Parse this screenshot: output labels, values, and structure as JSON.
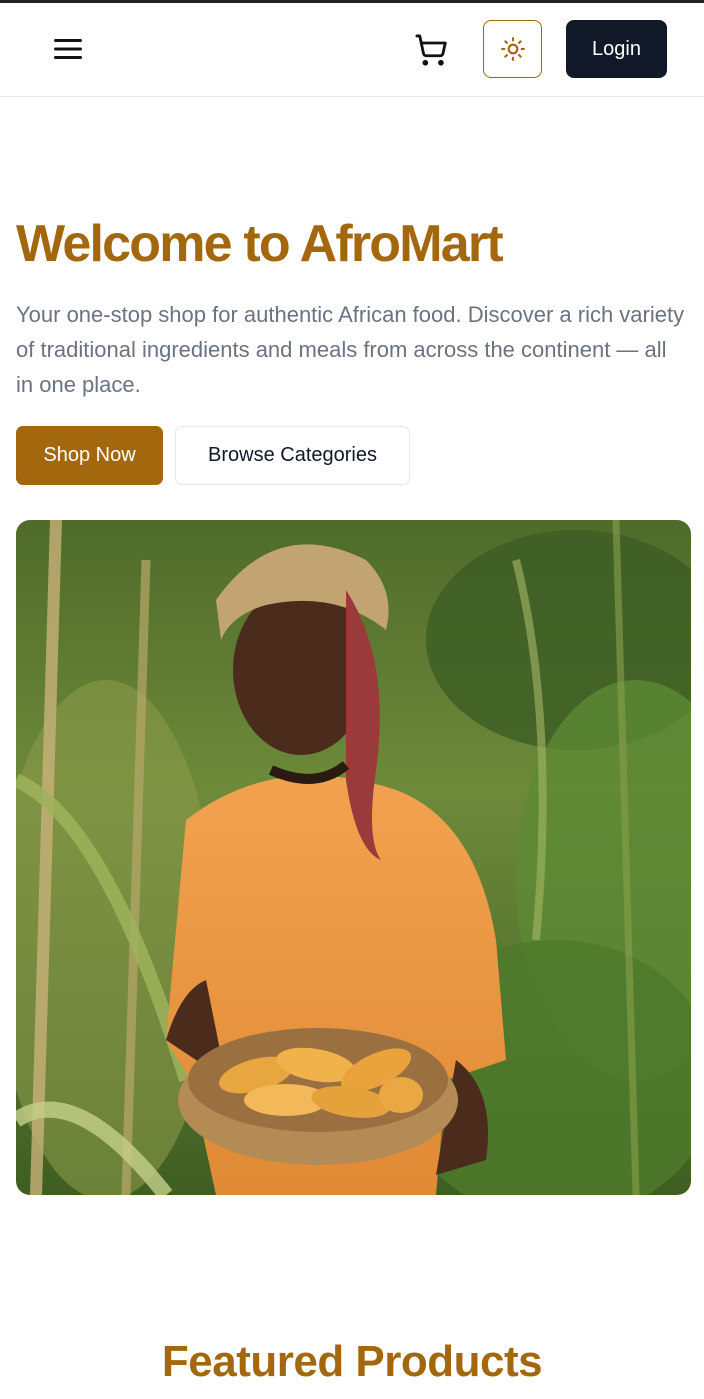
{
  "header": {
    "menu_icon": "hamburger-menu-icon",
    "cart_icon": "shopping-cart-icon",
    "theme_icon": "sun-icon",
    "login_label": "Login"
  },
  "hero": {
    "title": "Welcome to AfroMart",
    "description": "Your one-stop shop for authentic African food. Discover a rich variety of traditional ingredients and meals from across the continent — all in one place.",
    "shop_now_label": "Shop Now",
    "browse_categories_label": "Browse Categories",
    "image_subject": "woman-holding-basket-of-corn-in-field"
  },
  "featured": {
    "title": "Featured Products"
  },
  "colors": {
    "brand": "#a3680e",
    "dark": "#111827",
    "muted_text": "#6b7280",
    "border": "#e5e7eb"
  }
}
